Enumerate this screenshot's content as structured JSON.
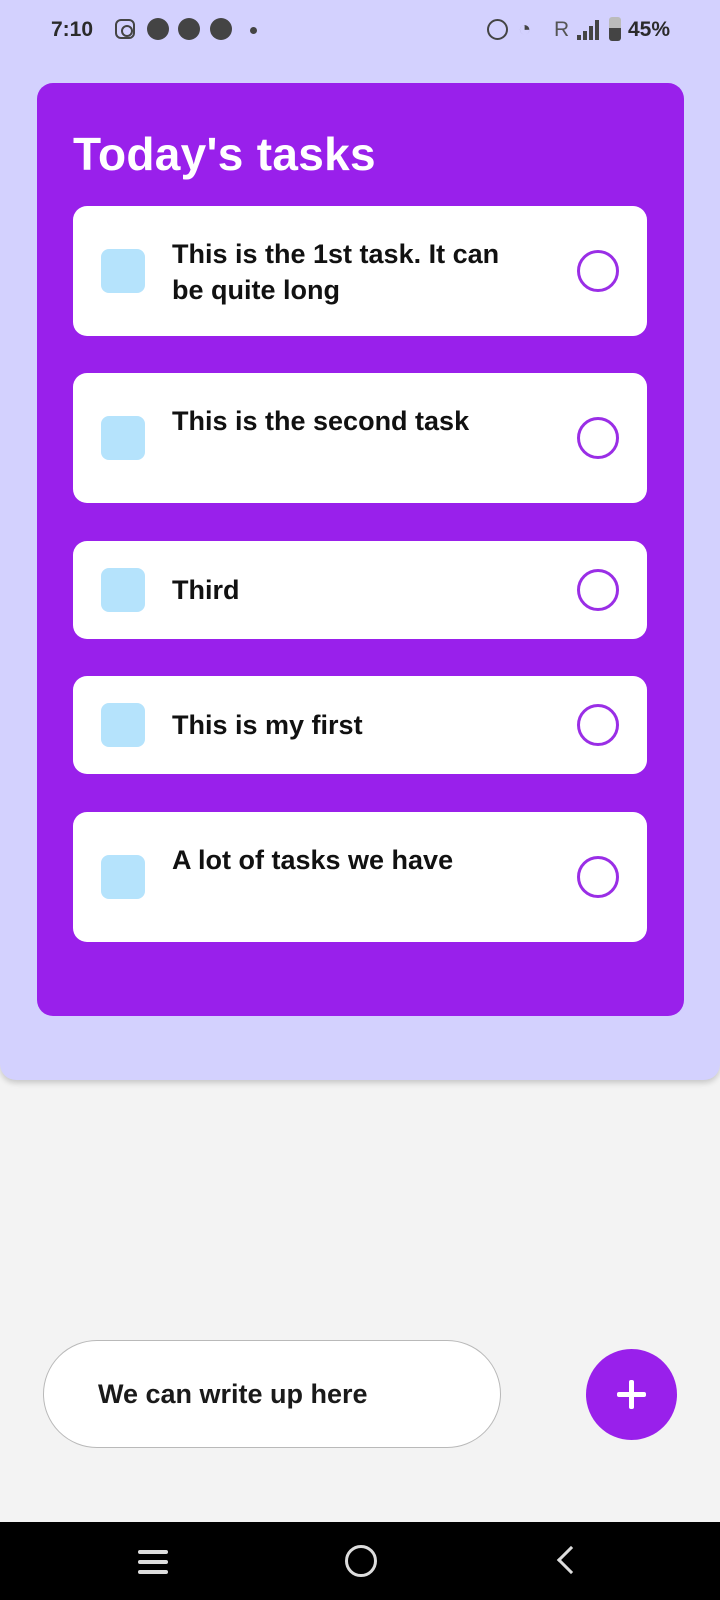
{
  "status_bar": {
    "time": "7:10",
    "network_label": "R",
    "battery": "45%",
    "icons": [
      "instagram-icon",
      "app-notification-icon",
      "app-notification-icon",
      "app-notification-icon",
      "more-dot-icon",
      "alarm-icon",
      "wifi-icon",
      "signal-icon",
      "battery-icon"
    ]
  },
  "tasks_card": {
    "title": "Today's tasks",
    "tasks": [
      {
        "text": "This is the 1st task. It can be quite long"
      },
      {
        "text": "This is the second task"
      },
      {
        "text": "Third"
      },
      {
        "text": "This is my first"
      },
      {
        "text": "A lot of tasks we have"
      }
    ]
  },
  "input": {
    "placeholder": "We can write up here"
  },
  "add_button": {
    "label": "+"
  },
  "colors": {
    "panel_bg": "#d3d1fe",
    "card_bg": "#9920eb",
    "square": "#b5e3fc",
    "circle": "#9a2ee6",
    "page_bg": "#f3f3f3"
  }
}
